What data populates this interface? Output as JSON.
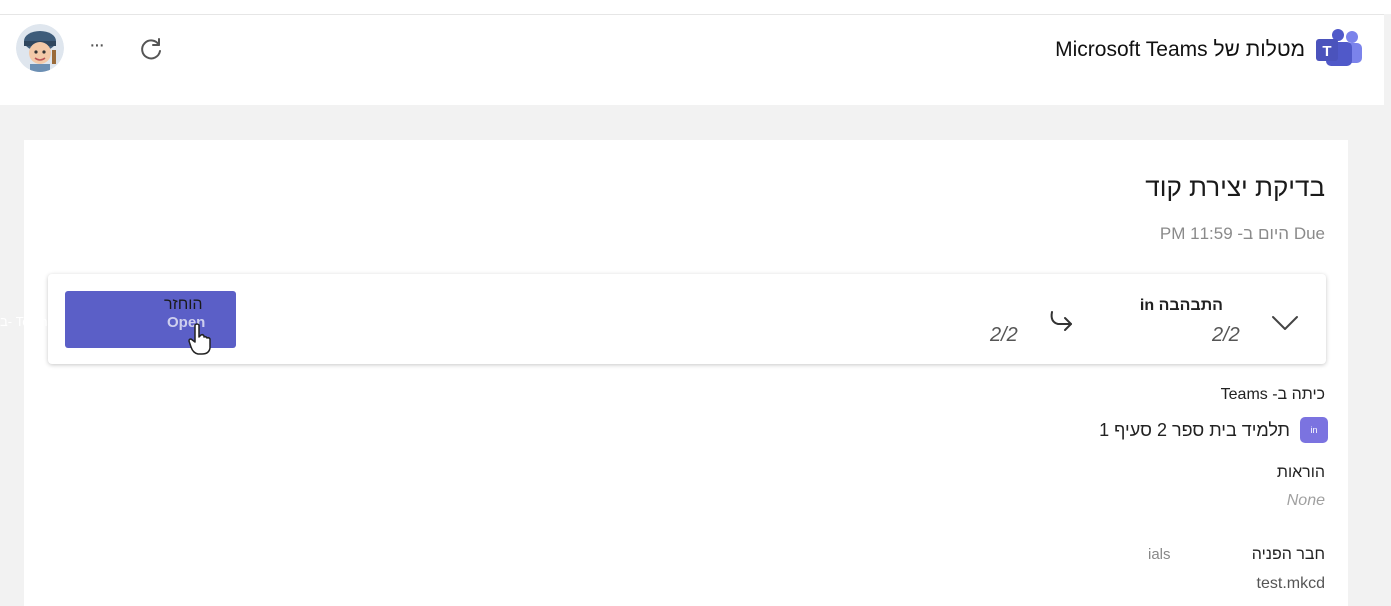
{
  "header": {
    "app_title": "מטלות של Microsoft Teams",
    "more_label": "···",
    "app_icon": "teams-icon",
    "refresh_icon": "refresh-icon",
    "avatar_icon": "avatar"
  },
  "assignment": {
    "title": "בדיקת יצירת קוד",
    "due": "Due היום ב- 11:59 PM"
  },
  "submission": {
    "file_name": "התבהבה in",
    "score_before": "2/2",
    "score_after": "2/2",
    "return_label": "הוחזר",
    "open_label": "Open",
    "teams_overlay": "ב- Teams"
  },
  "class_section": {
    "label": "כיתה ב- Teams",
    "badge": "in",
    "name": "תלמיד בית ספר 2 סעיף 1"
  },
  "instructions": {
    "label": "הוראות",
    "value": "None"
  },
  "peer": {
    "label": "חבר הפניה",
    "extra": "ials",
    "value": "test.mkcd"
  },
  "colors": {
    "accent": "#5b5fc7",
    "class_badge": "#7b73e0"
  }
}
